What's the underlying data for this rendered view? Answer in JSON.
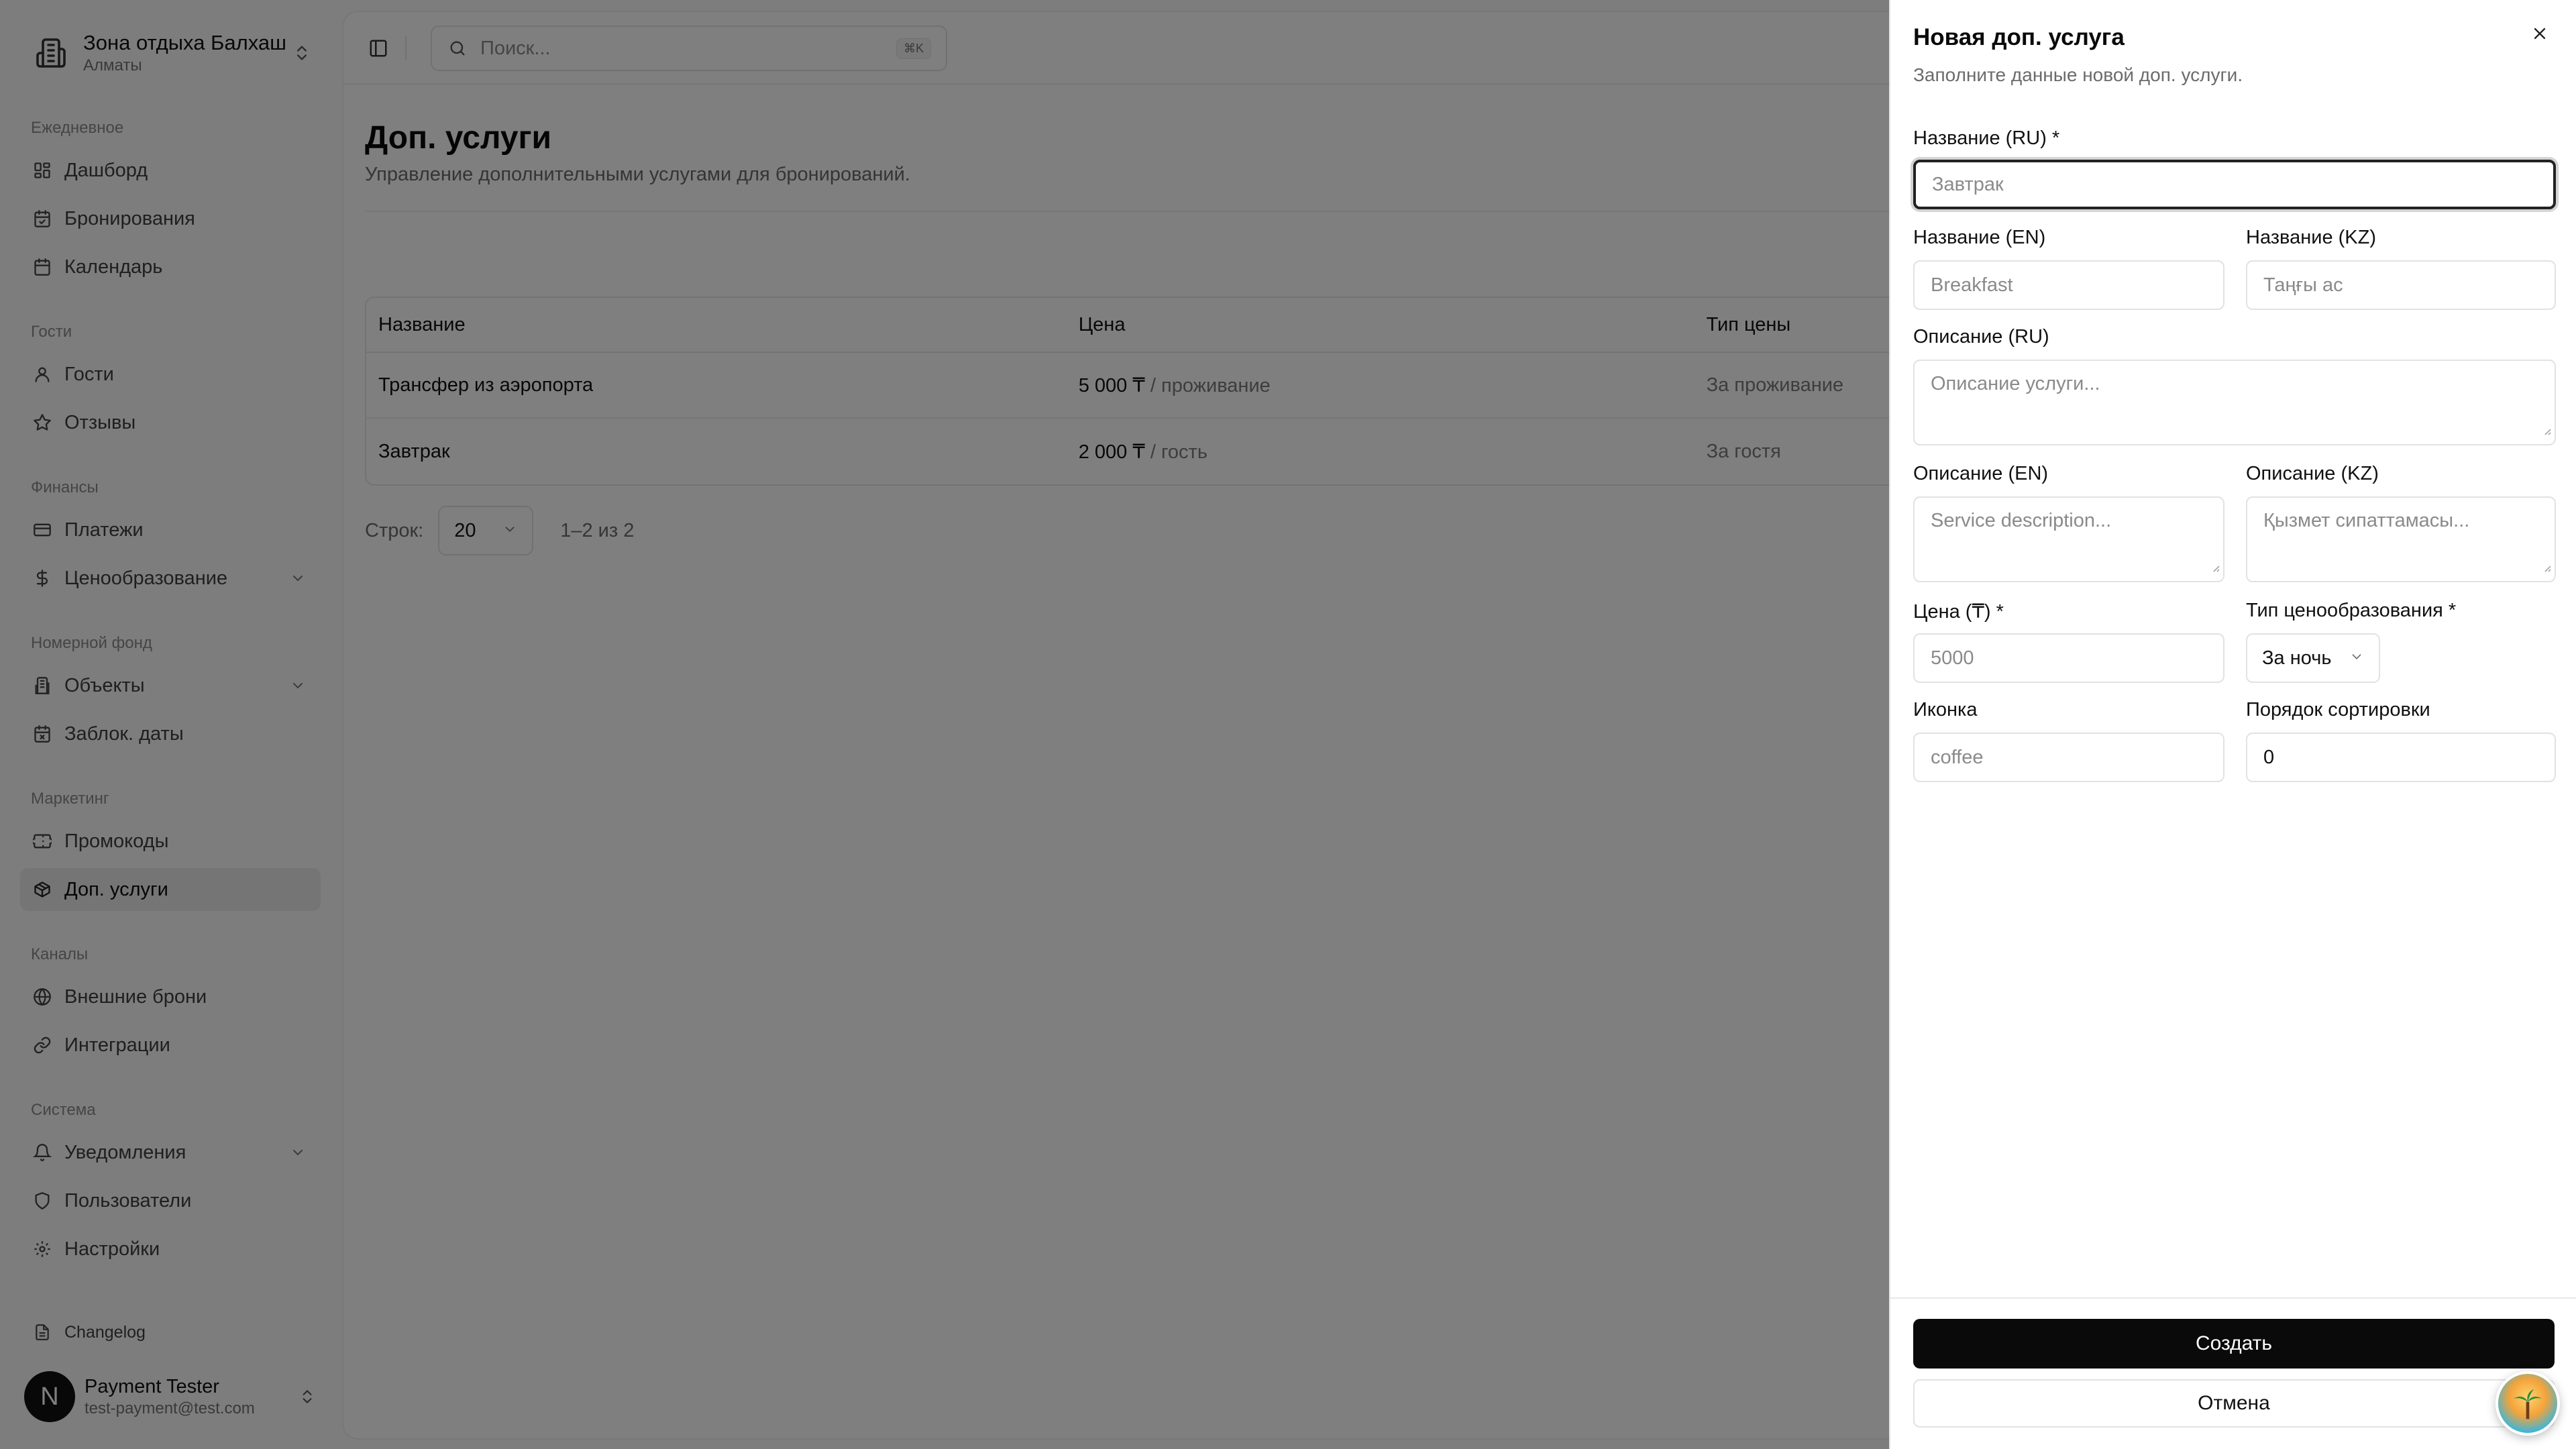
{
  "workspace": {
    "title": "Зона отдыха Балхаш",
    "subtitle": "Алматы"
  },
  "sidebar": {
    "sections": [
      {
        "label": "Ежедневное"
      },
      {
        "label": "Гости"
      },
      {
        "label": "Финансы"
      },
      {
        "label": "Номерной фонд"
      },
      {
        "label": "Маркетинг"
      },
      {
        "label": "Каналы"
      },
      {
        "label": "Система"
      }
    ],
    "items": [
      {
        "label": "Дашборд",
        "icon": "dashboard-icon"
      },
      {
        "label": "Бронирования",
        "icon": "calendar-check-icon"
      },
      {
        "label": "Календарь",
        "icon": "calendar-icon"
      },
      {
        "label": "Гости",
        "icon": "user-icon"
      },
      {
        "label": "Отзывы",
        "icon": "star-icon"
      },
      {
        "label": "Платежи",
        "icon": "wallet-icon"
      },
      {
        "label": "Ценообразование",
        "icon": "dollar-icon"
      },
      {
        "label": "Объекты",
        "icon": "building-icon"
      },
      {
        "label": "Заблок. даты",
        "icon": "calendar-x-icon"
      },
      {
        "label": "Промокоды",
        "icon": "ticket-icon"
      },
      {
        "label": "Доп. услуги",
        "icon": "package-icon"
      },
      {
        "label": "Внешние брони",
        "icon": "globe-icon"
      },
      {
        "label": "Интеграции",
        "icon": "link-icon"
      },
      {
        "label": "Уведомления",
        "icon": "bell-icon"
      },
      {
        "label": "Пользователи",
        "icon": "shield-icon"
      },
      {
        "label": "Настройки",
        "icon": "gear-icon"
      }
    ],
    "changelog": "Changelog",
    "user": {
      "initial": "N",
      "name": "Payment Tester",
      "email": "test-payment@test.com"
    }
  },
  "topbar": {
    "search_placeholder": "Поиск...",
    "shortcut": "⌘K"
  },
  "page": {
    "title": "Доп. услуги",
    "subtitle": "Управление дополнительными услугами для бронирований."
  },
  "table": {
    "headers": [
      "Название",
      "Цена",
      "Тип цены"
    ],
    "rows": [
      {
        "name": "Трансфер из аэропорта",
        "price": "5 000 ₸",
        "price_unit": "/ проживание",
        "type": "За проживание"
      },
      {
        "name": "Завтрак",
        "price": "2 000 ₸",
        "price_unit": "/ гость",
        "type": "За гостя"
      }
    ]
  },
  "pager": {
    "label": "Строк:",
    "value": "20",
    "range": "1–2 из 2"
  },
  "sheet": {
    "title": "Новая доп. услуга",
    "description": "Заполните данные новой доп. услуги.",
    "fields": {
      "name_ru": {
        "label": "Название (RU) *",
        "placeholder": "Завтрак"
      },
      "name_en": {
        "label": "Название (EN)",
        "placeholder": "Breakfast"
      },
      "name_kz": {
        "label": "Название (KZ)",
        "placeholder": "Таңғы ас"
      },
      "desc_ru": {
        "label": "Описание (RU)",
        "placeholder": "Описание услуги..."
      },
      "desc_en": {
        "label": "Описание (EN)",
        "placeholder": "Service description..."
      },
      "desc_kz": {
        "label": "Описание (KZ)",
        "placeholder": "Қызмет сипаттамасы..."
      },
      "price": {
        "label": "Цена (₸) *",
        "placeholder": "5000"
      },
      "pricing_type": {
        "label": "Тип ценообразования *",
        "value": "За ночь"
      },
      "icon": {
        "label": "Иконка",
        "placeholder": "coffee"
      },
      "sort_order": {
        "label": "Порядок сортировки",
        "value": "0"
      }
    },
    "create_label": "Создать",
    "cancel_label": "Отмена"
  }
}
